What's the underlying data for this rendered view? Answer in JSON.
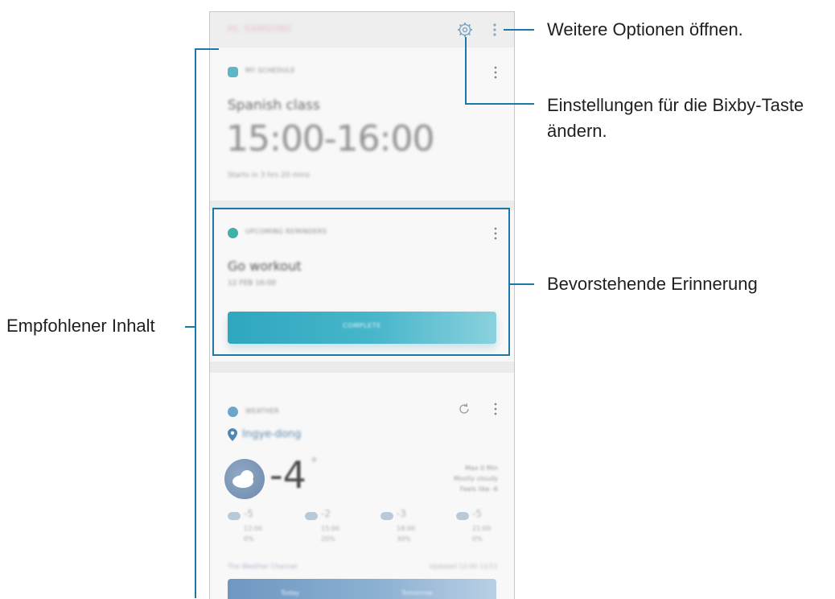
{
  "annotations": {
    "more_options": "Weitere Optionen öffnen.",
    "bixby_settings_line1": "Einstellungen für die Bixby-Taste",
    "bixby_settings_line2": "ändern.",
    "upcoming_reminder": "Bevorstehende Erinnerung",
    "recommended_content": "Empfohlener Inhalt"
  },
  "topbar": {
    "title": "HI, SAMSUNG"
  },
  "schedule_card": {
    "header": "MY SCHEDULE",
    "event": "Spanish class",
    "time": "15:00-16:00",
    "starts_in": "Starts in 3 hrs 20 mins"
  },
  "reminder_card": {
    "header": "UPCOMING REMINDERS",
    "title": "Go workout",
    "date": "12 FEB 16:00",
    "button": "COMPLETE"
  },
  "weather_card": {
    "header": "WEATHER",
    "location": "Ingye-dong",
    "temperature": "-4",
    "degree": "°",
    "details": [
      "Max 0 Min",
      "Mostly cloudy",
      "Feels like -6"
    ],
    "forecast": [
      {
        "temp": "-5",
        "time": "12:00",
        "pct": "0%"
      },
      {
        "temp": "-2",
        "time": "15:00",
        "pct": "20%"
      },
      {
        "temp": "-3",
        "time": "18:00",
        "pct": "30%"
      },
      {
        "temp": "-5",
        "time": "21:00",
        "pct": "0%"
      }
    ],
    "provider": "The Weather Channel",
    "updated": "Updated 12:00 11/11",
    "tabs": [
      "Today",
      "Tomorrow"
    ]
  },
  "colors": {
    "accent": "#1d78a8",
    "reminder_button": "#2ea7bf",
    "weather_tabs": "#6e98c1"
  }
}
